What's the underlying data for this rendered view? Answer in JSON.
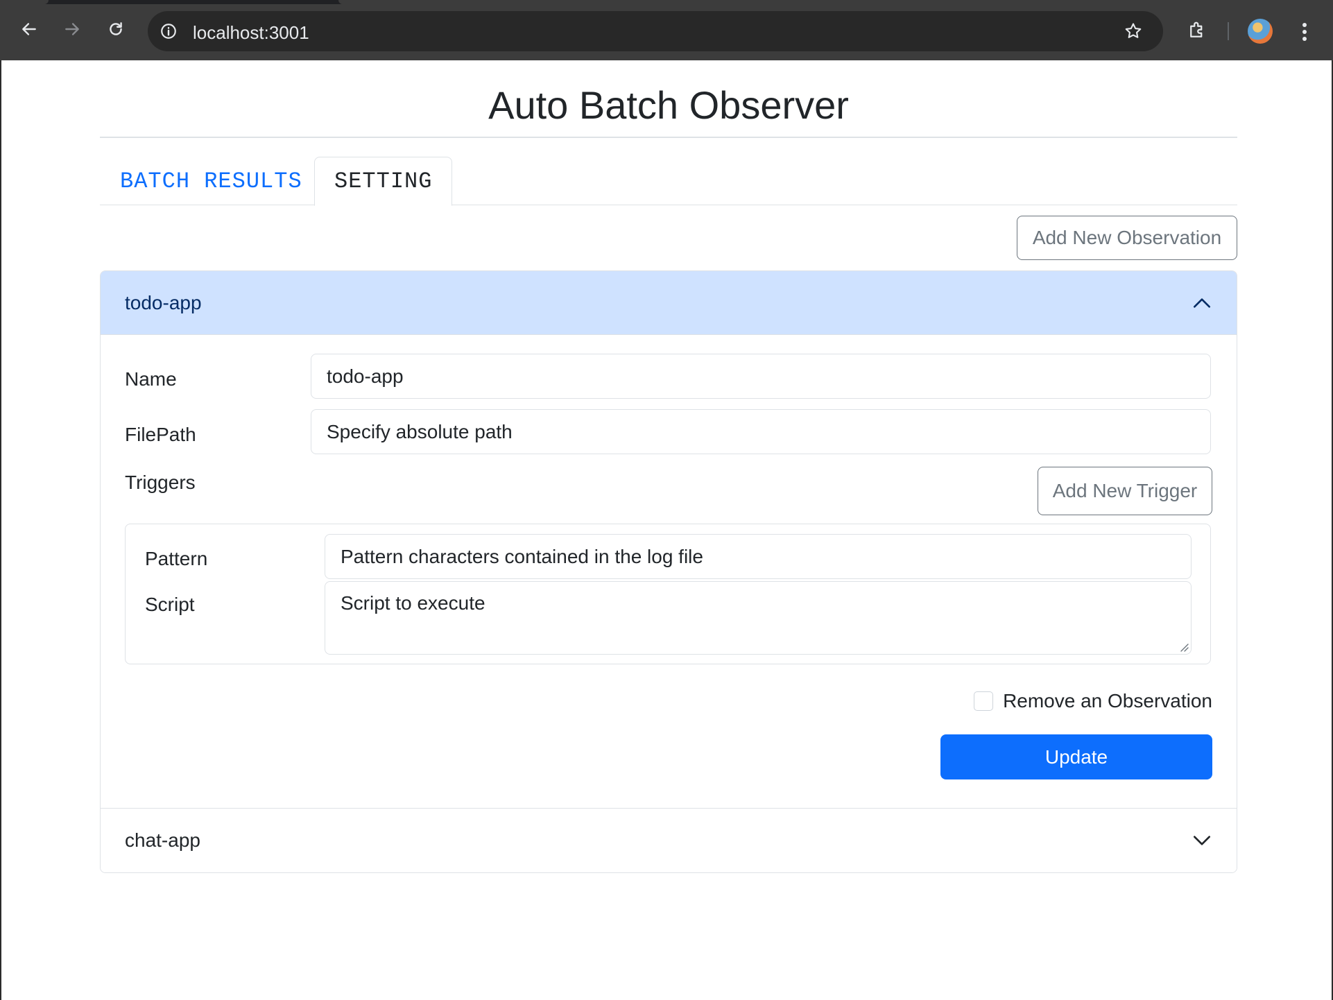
{
  "browser": {
    "url": "localhost:3001",
    "icons": [
      "back-icon",
      "forward-icon",
      "reload-icon",
      "site-info-icon",
      "bookmark-star-icon",
      "extensions-icon",
      "profile-avatar",
      "menu-dots-icon"
    ]
  },
  "page": {
    "title": "Auto Batch Observer"
  },
  "tabs": [
    {
      "label": "BATCH RESULTS",
      "active": false
    },
    {
      "label": "SETTING",
      "active": true
    }
  ],
  "toolbar": {
    "add_observation_label": "Add New Observation"
  },
  "observations": [
    {
      "header": "todo-app",
      "expanded": true,
      "form": {
        "name_label": "Name",
        "name_value": "todo-app",
        "filepath_label": "FilePath",
        "filepath_placeholder": "Specify absolute path",
        "triggers_label": "Triggers",
        "add_trigger_label": "Add New Trigger",
        "trigger": {
          "pattern_label": "Pattern",
          "pattern_placeholder": "Pattern characters contained in the log file",
          "script_label": "Script",
          "script_placeholder": "Script to execute"
        },
        "remove_label": "Remove an Observation",
        "remove_checked": false,
        "update_label": "Update"
      }
    },
    {
      "header": "chat-app",
      "expanded": false
    }
  ],
  "colors": {
    "primary": "#0d6efd",
    "accordion_open_bg": "#cfe2ff",
    "border": "#dee2e6",
    "outline_button": "#6c757d"
  }
}
